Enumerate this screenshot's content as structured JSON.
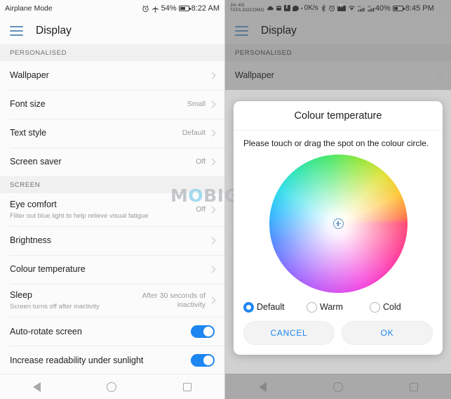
{
  "left": {
    "statusbar": {
      "label": "Airplane Mode",
      "icons": [
        "alarm-icon",
        "airplane-icon"
      ],
      "battery_percent": "54%",
      "time": "8:22 AM"
    },
    "appbar": {
      "menu_icon": "hamburger-icon",
      "title": "Display"
    },
    "sections": [
      {
        "header": "PERSONALISED",
        "rows": [
          {
            "title": "Wallpaper",
            "sub": "",
            "value": "",
            "control": "chevron"
          },
          {
            "title": "Font size",
            "sub": "",
            "value": "Small",
            "control": "chevron"
          },
          {
            "title": "Text style",
            "sub": "",
            "value": "Default",
            "control": "chevron"
          },
          {
            "title": "Screen saver",
            "sub": "",
            "value": "Off",
            "control": "chevron"
          }
        ]
      },
      {
        "header": "SCREEN",
        "rows": [
          {
            "title": "Eye comfort",
            "sub": "Filter out blue light to help relieve visual fatigue",
            "value": "Off",
            "control": "chevron"
          },
          {
            "title": "Brightness",
            "sub": "",
            "value": "",
            "control": "chevron"
          },
          {
            "title": "Colour temperature",
            "sub": "",
            "value": "",
            "control": "chevron"
          },
          {
            "title": "Sleep",
            "sub": "Screen turns off after inactivity",
            "value": "After 30 seconds of inactivity",
            "control": "chevron"
          },
          {
            "title": "Auto-rotate screen",
            "sub": "",
            "value": "",
            "control": "toggle-on"
          },
          {
            "title": "Increase readability under sunlight",
            "sub": "",
            "value": "",
            "control": "toggle-on"
          }
        ]
      }
    ]
  },
  "right": {
    "statusbar": {
      "carrier_line1": "Jio 4G",
      "carrier_line2": "TATA DOCOMO",
      "data_rate": "0K/s",
      "icons": [
        "cloud-upload-icon",
        "calendar-icon",
        "facebook-icon",
        "chat-bubble-icon",
        "bluetooth-icon",
        "alarm-icon",
        "hd-icon",
        "wifi-icon",
        "signal-4g-icon",
        "signal-3g-icon"
      ],
      "battery_percent": "40%",
      "time": "8:45 PM"
    },
    "appbar": {
      "menu_icon": "hamburger-icon",
      "title": "Display"
    },
    "section_header": "PERSONALISED",
    "row_wallpaper": "Wallpaper",
    "dialog": {
      "title": "Colour temperature",
      "description": "Please touch or drag the spot on the colour circle.",
      "wheel": {
        "name": "colour-wheel",
        "spot_icon": "crosshair-spot-icon"
      },
      "options": [
        {
          "label": "Default",
          "selected": true
        },
        {
          "label": "Warm",
          "selected": false
        },
        {
          "label": "Cold",
          "selected": false
        }
      ],
      "cancel_label": "CANCEL",
      "ok_label": "OK"
    }
  },
  "watermark": {
    "text_1": "M",
    "text_o": "O",
    "text_2": "BIGYAAN"
  },
  "navbar": {
    "back": "back-icon",
    "home": "home-icon",
    "recents": "recents-icon"
  },
  "colors": {
    "accent": "#1e86f0",
    "menu_icon": "#5f93bd",
    "section_bg": "#f0f0f0"
  }
}
